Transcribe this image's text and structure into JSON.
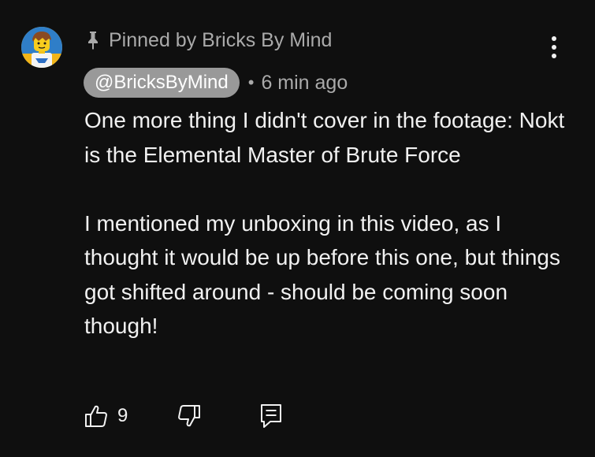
{
  "comment": {
    "pinned_label": "Pinned by Bricks By Mind",
    "author_handle": "@BricksByMind",
    "separator": "•",
    "timestamp": "6 min ago",
    "paragraphs": [
      "One more thing I didn't cover in the footage: Nokt is the Elemental Master of Brute Force",
      "I mentioned my unboxing in this video, as I thought it would be up before this one, but things got shifted around - should be coming soon though!"
    ],
    "like_count": "9"
  },
  "icons": {
    "avatar": "avatar",
    "pin": "pin-icon",
    "more": "more-vert-icon",
    "like": "thumbs-up-icon",
    "dislike": "thumbs-down-icon",
    "reply": "comment-reply-icon"
  },
  "colors": {
    "background": "#0f0f0f",
    "text": "#f1f1f1",
    "secondary_text": "#aaaaaa",
    "author_chip": "#999999"
  }
}
